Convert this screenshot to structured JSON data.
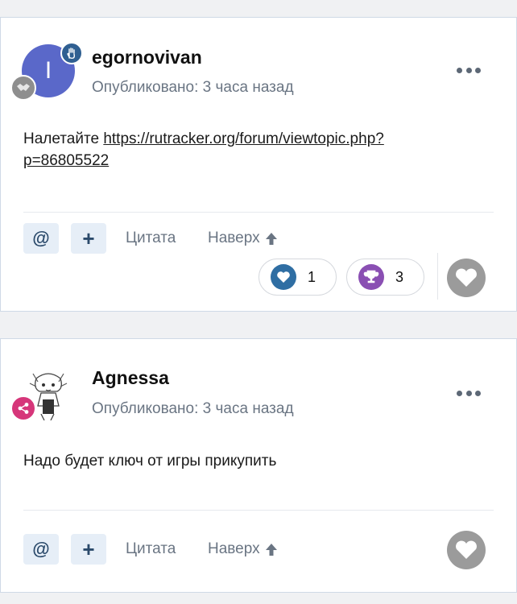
{
  "posts": [
    {
      "author": "egornovivan",
      "avatar_letter": "I",
      "avatar_color": "#5a68c9",
      "role_icon": "hand-icon",
      "rank_icon": "handshake-icon",
      "published": "Опубликовано: 3 часа назад",
      "content_prefix": "Налетайте ",
      "content_link": "https://rutracker.org/forum/viewtopic.php?p=86805522",
      "content_link_line1": "https://rutracker.org/forum/viewtopic.php?",
      "content_link_line2": "p=86805522",
      "actions": {
        "mention": "@",
        "multiquote": "+",
        "quote": "Цитата",
        "top": "Наверх"
      },
      "reactions": [
        {
          "icon": "heart-icon",
          "count": "1",
          "color": "#2f6ea3"
        },
        {
          "icon": "trophy-icon",
          "count": "3",
          "color": "#8a4fb3"
        }
      ]
    },
    {
      "author": "Agnessa",
      "avatar_icon": "anime-avatar",
      "rank_icon": "share-icon",
      "rank_color": "#d6367a",
      "published": "Опубликовано: 3 часа назад",
      "content": "Надо будет ключ от игры прикупить",
      "actions": {
        "mention": "@",
        "multiquote": "+",
        "quote": "Цитата",
        "top": "Наверх"
      }
    }
  ]
}
